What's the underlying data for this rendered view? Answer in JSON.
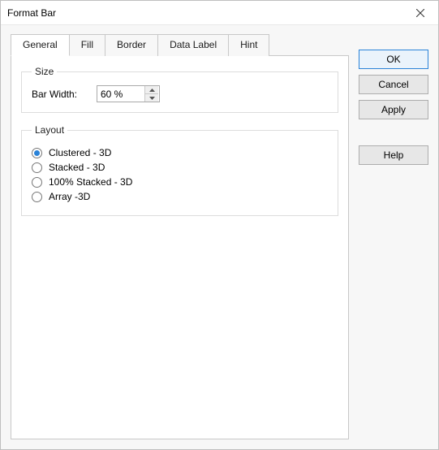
{
  "window": {
    "title": "Format Bar"
  },
  "tabs": {
    "general": "General",
    "fill": "Fill",
    "border": "Border",
    "dataLabel": "Data Label",
    "hint": "Hint"
  },
  "size": {
    "legend": "Size",
    "barWidthLabel": "Bar Width:",
    "barWidthValue": "60 %"
  },
  "layout": {
    "legend": "Layout",
    "options": {
      "clustered": "Clustered - 3D",
      "stacked": "Stacked - 3D",
      "stacked100": "100% Stacked - 3D",
      "array": "Array -3D"
    },
    "selected": "clustered"
  },
  "buttons": {
    "ok": "OK",
    "cancel": "Cancel",
    "apply": "Apply",
    "help": "Help"
  }
}
